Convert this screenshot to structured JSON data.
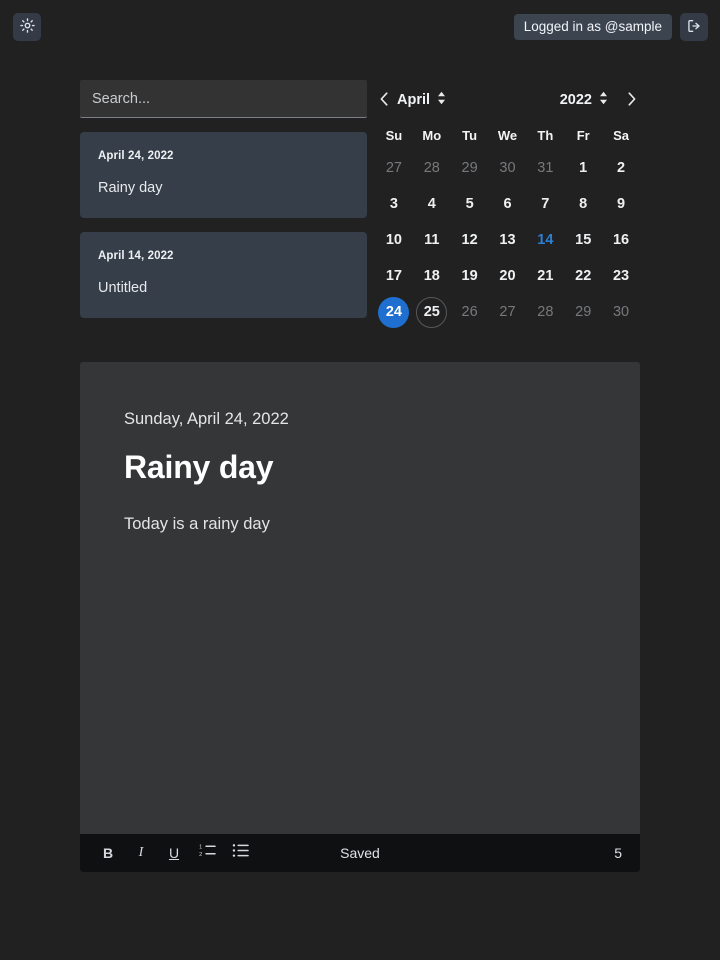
{
  "topbar": {
    "theme_toggle_icon": "sun-icon",
    "login_status": "Logged in as @sample",
    "logout_icon": "logout-icon"
  },
  "search": {
    "placeholder": "Search...",
    "value": ""
  },
  "notes": [
    {
      "date": "April 24, 2022",
      "title": "Rainy day"
    },
    {
      "date": "April 14, 2022",
      "title": "Untitled"
    }
  ],
  "calendar": {
    "prev_icon": "chevron-left-icon",
    "next_icon": "chevron-right-icon",
    "month": "April",
    "year": "2022",
    "month_stepper_icon": "chevron-up-down-icon",
    "year_stepper_icon": "chevron-up-down-icon",
    "weekdays": [
      "Su",
      "Mo",
      "Tu",
      "We",
      "Th",
      "Fr",
      "Sa"
    ],
    "accent_color": "#1f6fd0",
    "note_color": "#2b7fd4",
    "weeks": [
      [
        {
          "day": "27",
          "state": "muted"
        },
        {
          "day": "28",
          "state": "muted"
        },
        {
          "day": "29",
          "state": "muted"
        },
        {
          "day": "30",
          "state": "muted"
        },
        {
          "day": "31",
          "state": "muted"
        },
        {
          "day": "1",
          "state": "normal"
        },
        {
          "day": "2",
          "state": "normal"
        }
      ],
      [
        {
          "day": "3",
          "state": "normal"
        },
        {
          "day": "4",
          "state": "normal"
        },
        {
          "day": "5",
          "state": "normal"
        },
        {
          "day": "6",
          "state": "normal"
        },
        {
          "day": "7",
          "state": "normal"
        },
        {
          "day": "8",
          "state": "normal"
        },
        {
          "day": "9",
          "state": "normal"
        }
      ],
      [
        {
          "day": "10",
          "state": "normal"
        },
        {
          "day": "11",
          "state": "normal"
        },
        {
          "day": "12",
          "state": "normal"
        },
        {
          "day": "13",
          "state": "normal"
        },
        {
          "day": "14",
          "state": "hasnote"
        },
        {
          "day": "15",
          "state": "normal"
        },
        {
          "day": "16",
          "state": "normal"
        }
      ],
      [
        {
          "day": "17",
          "state": "normal"
        },
        {
          "day": "18",
          "state": "normal"
        },
        {
          "day": "19",
          "state": "normal"
        },
        {
          "day": "20",
          "state": "normal"
        },
        {
          "day": "21",
          "state": "normal"
        },
        {
          "day": "22",
          "state": "normal"
        },
        {
          "day": "23",
          "state": "normal"
        }
      ],
      [
        {
          "day": "24",
          "state": "selected"
        },
        {
          "day": "25",
          "state": "today"
        },
        {
          "day": "26",
          "state": "muted"
        },
        {
          "day": "27",
          "state": "muted"
        },
        {
          "day": "28",
          "state": "muted"
        },
        {
          "day": "29",
          "state": "muted"
        },
        {
          "day": "30",
          "state": "muted"
        }
      ]
    ]
  },
  "editor": {
    "date_label": "Sunday, April 24, 2022",
    "title": "Rainy day",
    "content": "Today is a rainy day",
    "toolbar": {
      "bold_label": "B",
      "italic_label": "I",
      "underline_label": "U",
      "ordered_list_icon": "ordered-list-icon",
      "bullet_list_icon": "bullet-list-icon",
      "save_status": "Saved",
      "char_count": "5"
    }
  }
}
